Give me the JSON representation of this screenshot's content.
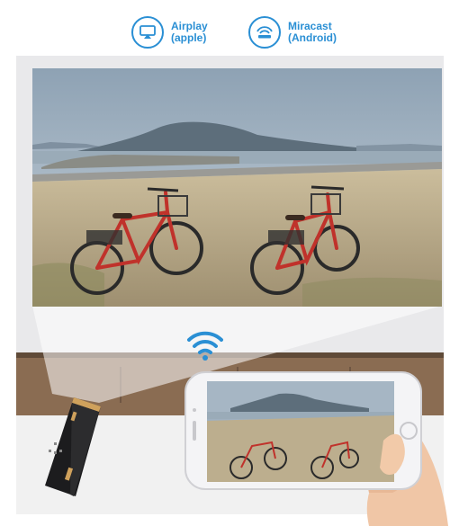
{
  "features": [
    {
      "icon": "airplay-icon",
      "line1": "Airplay",
      "line2": "(apple)"
    },
    {
      "icon": "miracast-icon",
      "line1": "Miracast",
      "line2": "(Android)"
    }
  ],
  "colors": {
    "accent": "#2a8fd4",
    "sky": "#9fb0c0",
    "sand": "#b7a88a",
    "bike": "#c0322b",
    "shelf": "#8a6c52"
  }
}
